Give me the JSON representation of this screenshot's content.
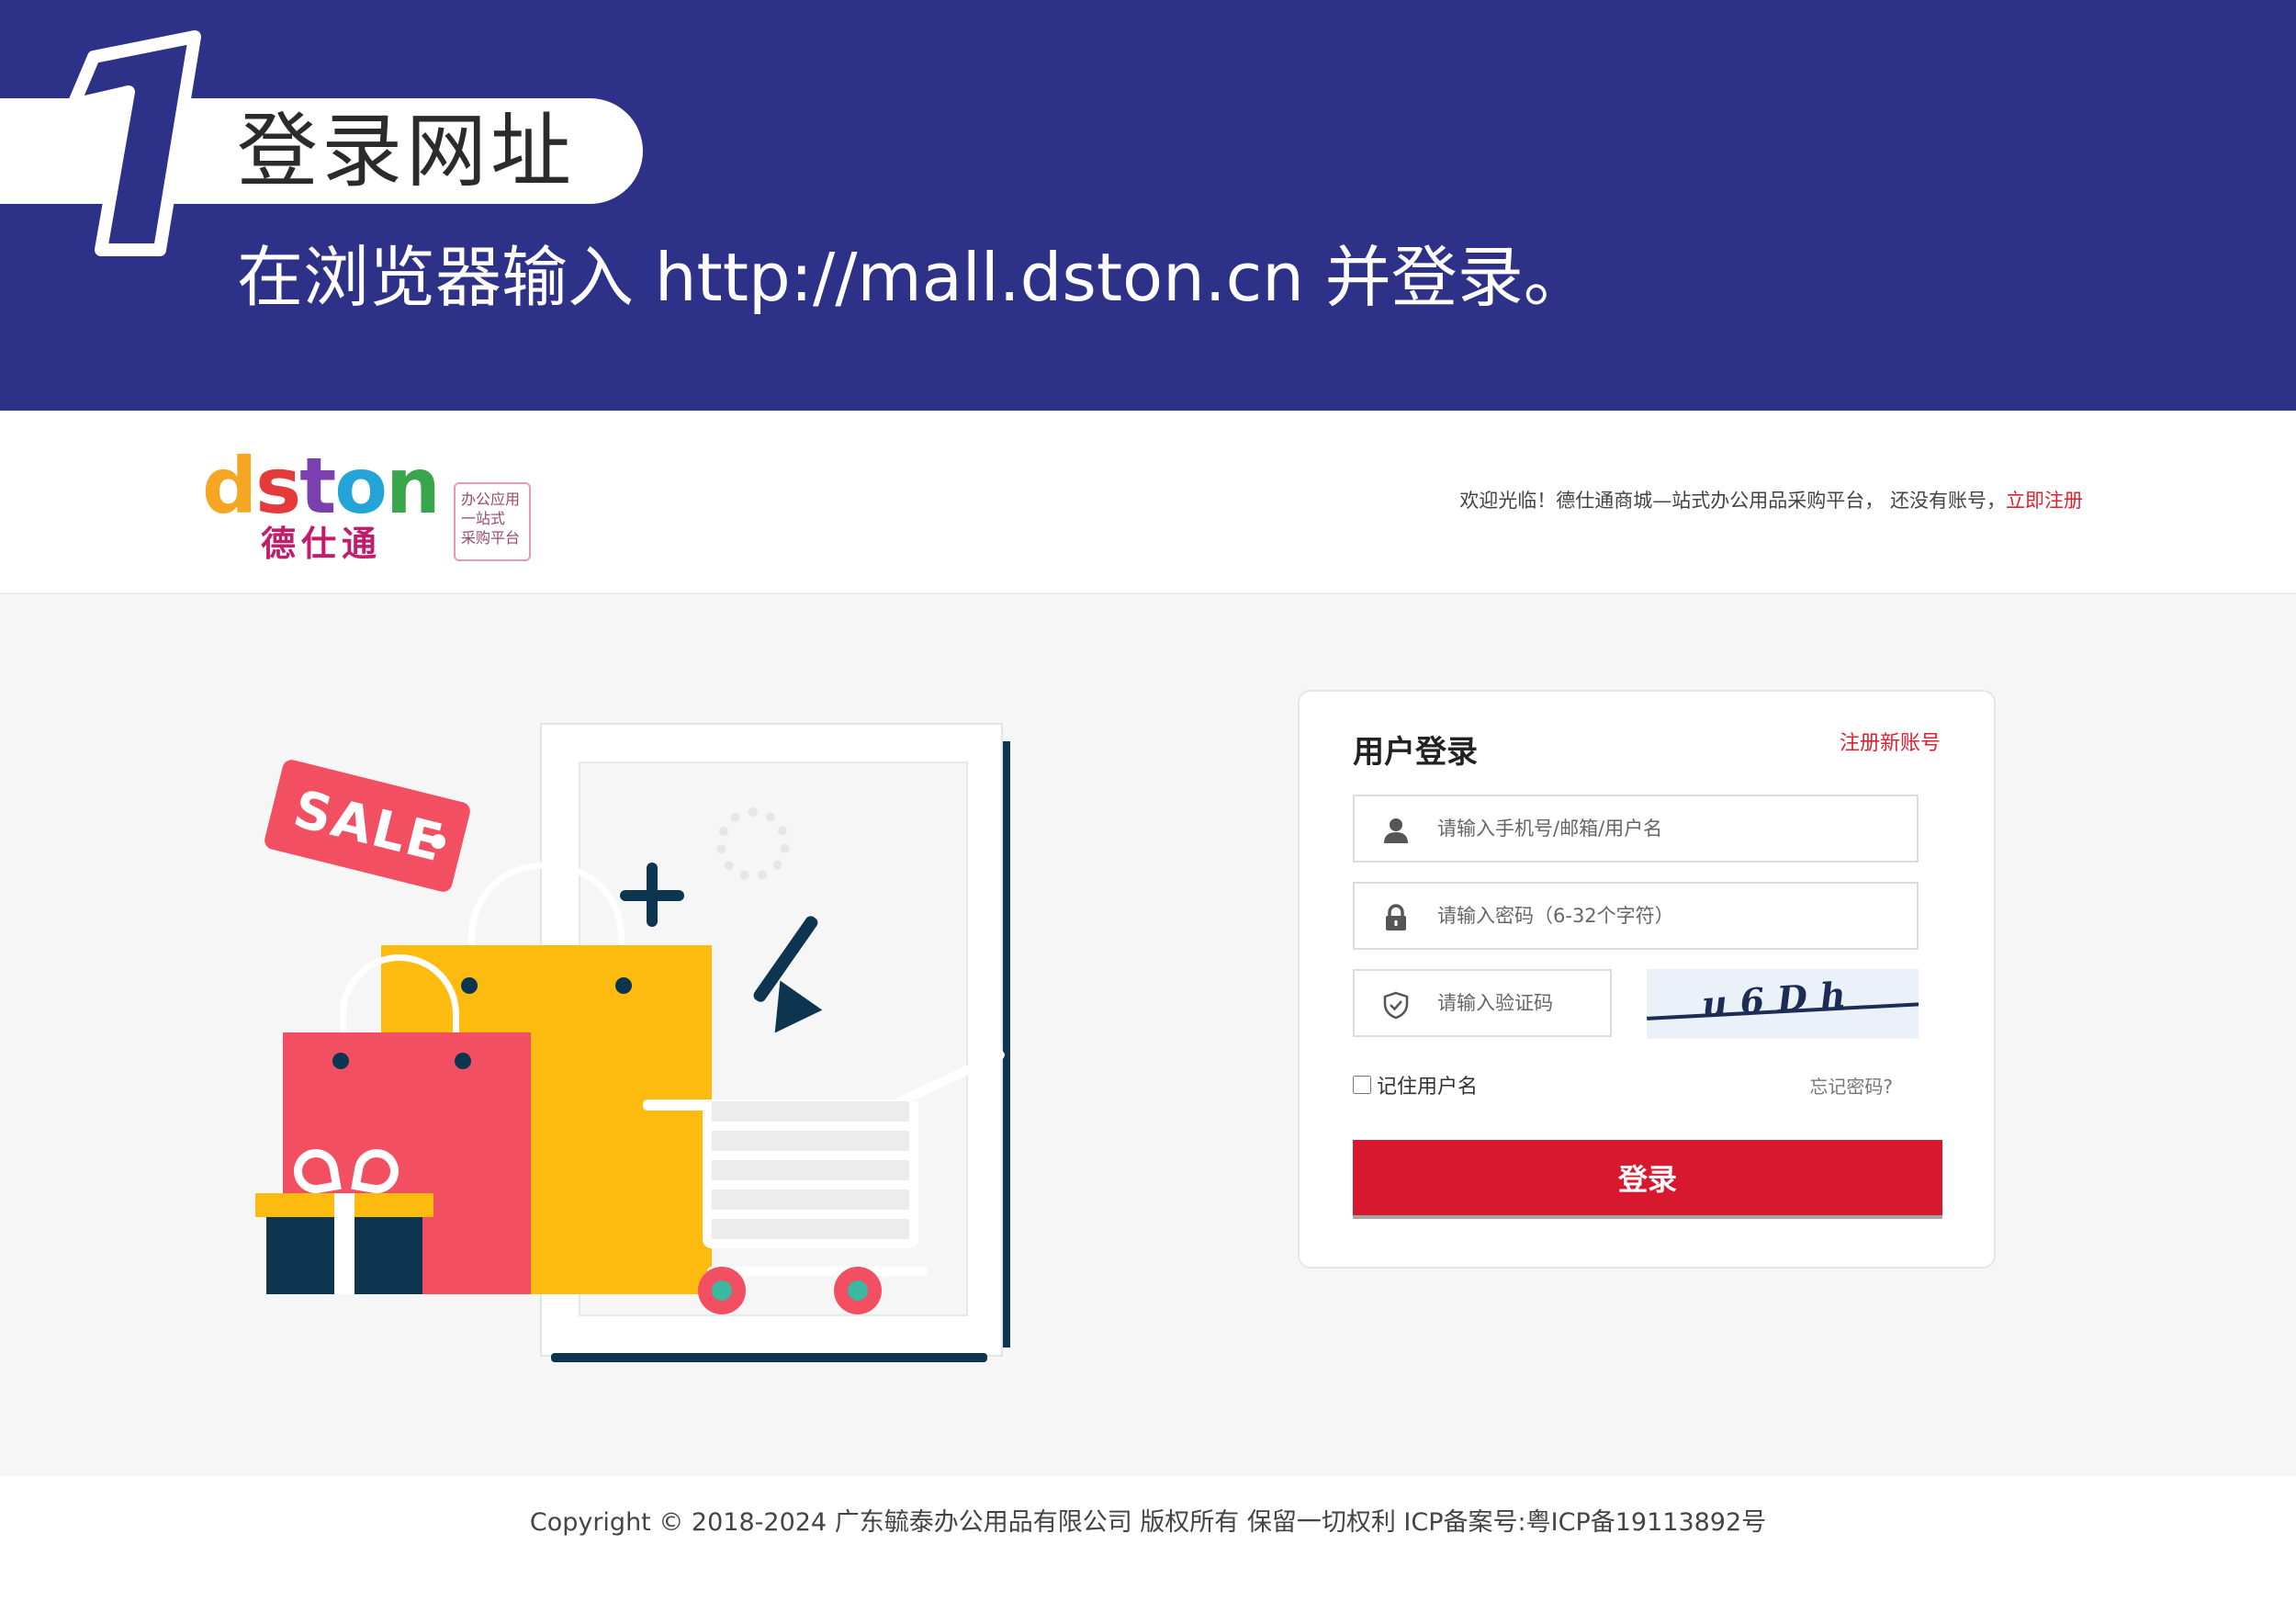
{
  "banner": {
    "step_number": "1",
    "title": "登录网址",
    "description": "在浏览器输入 http://mall.dston.cn 并登录。"
  },
  "header": {
    "logo_word": [
      "d",
      "s",
      "t",
      "o",
      "n"
    ],
    "logo_cn": "德仕通",
    "logo_tagline": [
      "办公应用",
      "一站式",
      "采购平台"
    ],
    "welcome_text": "欢迎光临！德仕通商城—站式办公用品采购平台， 还没有账号，",
    "register_link": "立即注册"
  },
  "illustration": {
    "sale_tag": "SALE"
  },
  "login": {
    "title": "用户登录",
    "register_link": "注册新账号",
    "username_placeholder": "请输入手机号/邮箱/用户名",
    "password_placeholder": "请输入密码（6-32个字符）",
    "captcha_placeholder": "请输入验证码",
    "captcha_text": "u6Dh",
    "remember_label": "记住用户名",
    "remember_checked": false,
    "forgot_link": "忘记密码?",
    "submit_label": "登录"
  },
  "footer": {
    "copyright": "Copyright © 2018-2024 广东毓泰办公用品有限公司 版权所有 保留一切权利 ICP备案号:粤ICP备19113892号"
  },
  "colors": {
    "banner_bg": "#2e3188",
    "primary_red": "#d8182f",
    "link_red": "#e0202e",
    "logo_letters": [
      "#f5a623",
      "#e43a3a",
      "#7b3fb0",
      "#25a4d9",
      "#3aa64c"
    ]
  }
}
